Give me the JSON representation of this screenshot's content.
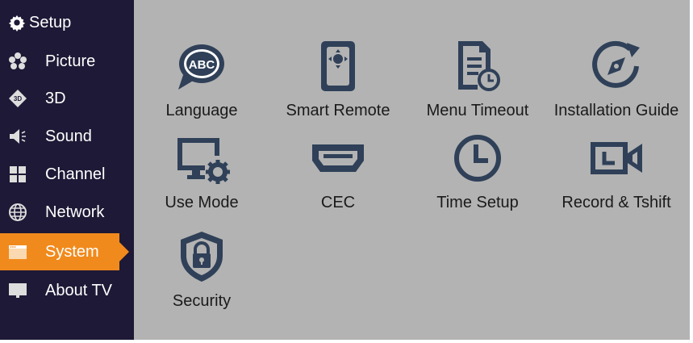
{
  "colors": {
    "sidebar_bg": "#1d1936",
    "content_bg": "#b3b3b3",
    "active": "#f18a1c",
    "icon": "#2f4058"
  },
  "sidebar": {
    "header": {
      "label": "Setup",
      "icon": "gear-icon"
    },
    "items": [
      {
        "label": "Picture",
        "icon": "picture-icon",
        "active": false
      },
      {
        "label": "3D",
        "icon": "3d-icon",
        "active": false
      },
      {
        "label": "Sound",
        "icon": "speaker-icon",
        "active": false
      },
      {
        "label": "Channel",
        "icon": "grid-icon",
        "active": false
      },
      {
        "label": "Network",
        "icon": "globe-icon",
        "active": false
      },
      {
        "label": "System",
        "icon": "window-icon",
        "active": true
      },
      {
        "label": "About TV",
        "icon": "monitor-icon",
        "active": false
      }
    ]
  },
  "main": {
    "tiles": [
      {
        "label": "Language",
        "icon": "speech-bubble-icon"
      },
      {
        "label": "Smart Remote",
        "icon": "remote-icon"
      },
      {
        "label": "Menu Timeout",
        "icon": "document-clock-icon"
      },
      {
        "label": "Installation Guide",
        "icon": "compass-icon"
      },
      {
        "label": "Use Mode",
        "icon": "monitor-gear-icon"
      },
      {
        "label": "CEC",
        "icon": "hdmi-icon"
      },
      {
        "label": "Time Setup",
        "icon": "clock-icon"
      },
      {
        "label": "Record & Tshift",
        "icon": "video-camera-icon"
      },
      {
        "label": "Security",
        "icon": "shield-lock-icon"
      }
    ]
  }
}
